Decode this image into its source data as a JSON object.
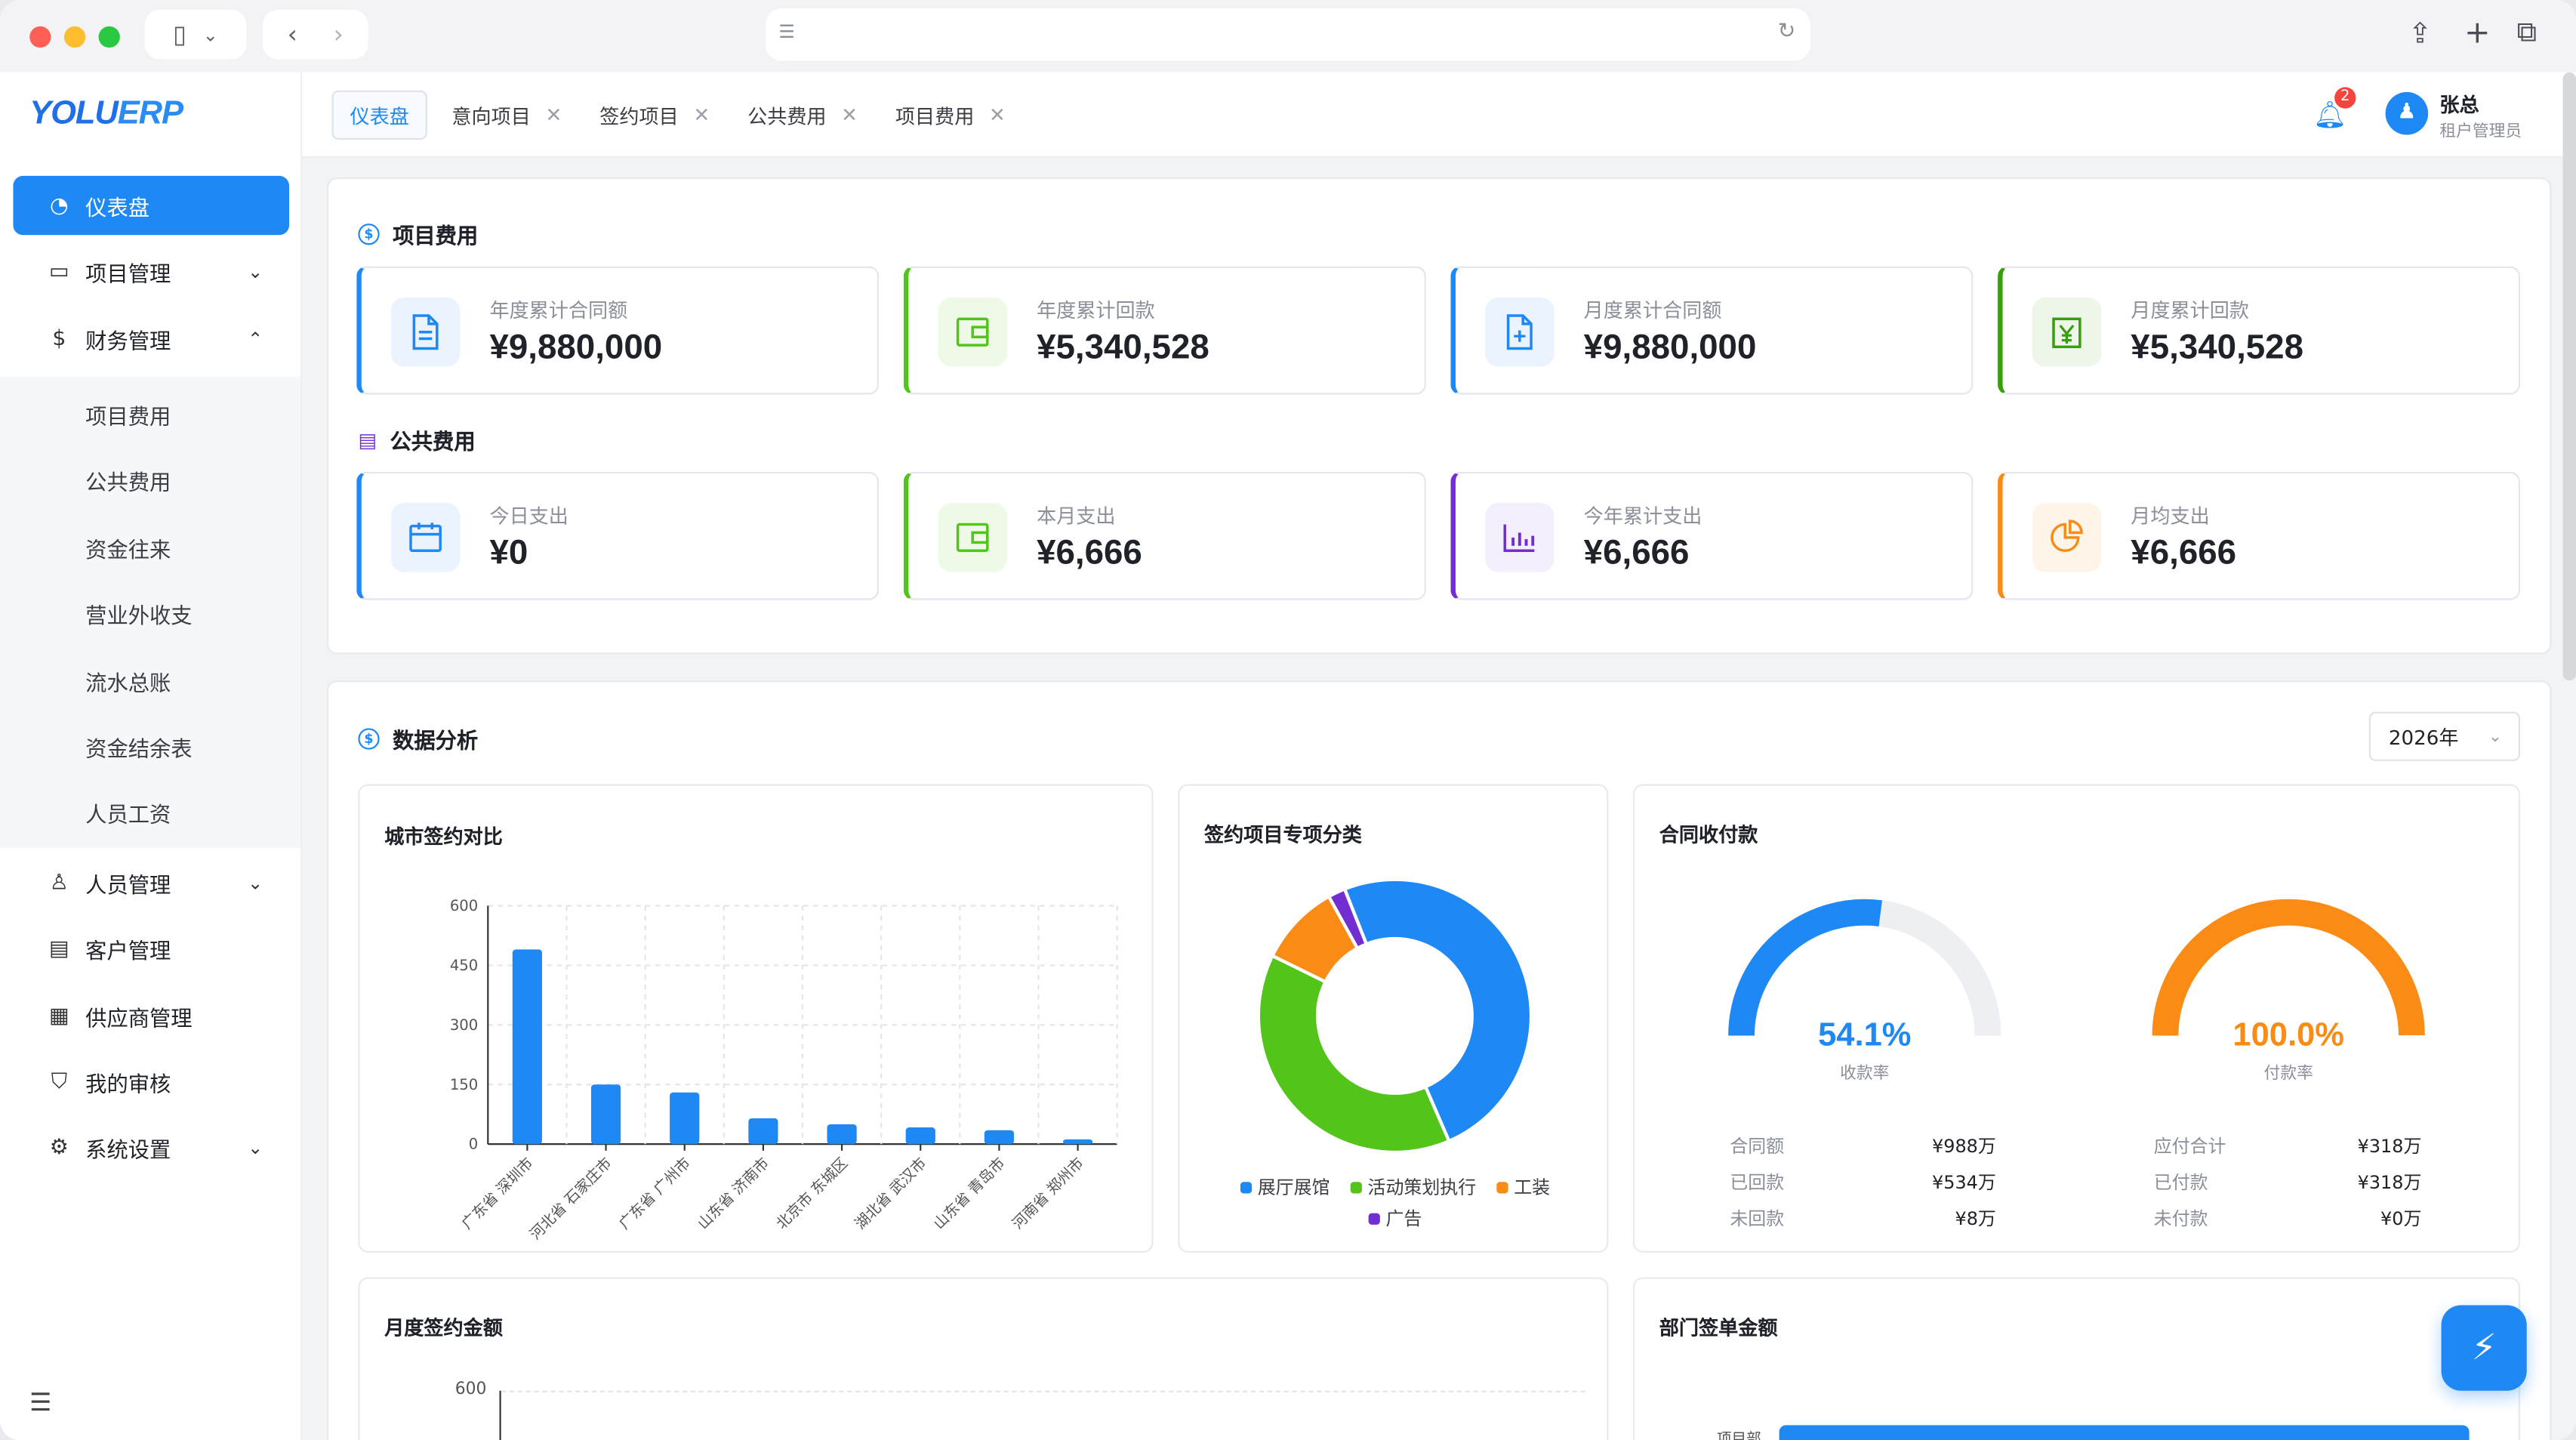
{
  "browser": {
    "url": ""
  },
  "sidebar": {
    "logo_main": "YOLU",
    "logo_accent": "ERP",
    "items": [
      {
        "label": "仪表盘",
        "icon": "dashboard-icon"
      },
      {
        "label": "项目管理",
        "icon": "folder-icon"
      },
      {
        "label": "财务管理",
        "icon": "finance-icon"
      },
      {
        "label": "人员管理",
        "icon": "people-icon"
      },
      {
        "label": "客户管理",
        "icon": "customer-icon"
      },
      {
        "label": "供应商管理",
        "icon": "supplier-icon"
      },
      {
        "label": "我的审核",
        "icon": "shield-icon"
      },
      {
        "label": "系统设置",
        "icon": "gear-icon"
      }
    ],
    "finance_sub": [
      "项目费用",
      "公共费用",
      "资金往来",
      "营业外收支",
      "流水总账",
      "资金结余表",
      "人员工资"
    ]
  },
  "tabs": [
    {
      "label": "仪表盘"
    },
    {
      "label": "意向项目"
    },
    {
      "label": "签约项目"
    },
    {
      "label": "公共费用"
    },
    {
      "label": "项目费用"
    }
  ],
  "header": {
    "notification_count": "2",
    "user_name": "张总",
    "user_role": "租户管理员"
  },
  "project_cost": {
    "title": "项目费用",
    "cards": [
      {
        "label": "年度累计合同额",
        "value": "¥9,880,000",
        "color": "#1e88f5"
      },
      {
        "label": "年度累计回款",
        "value": "¥5,340,528",
        "color": "#52c41a"
      },
      {
        "label": "月度累计合同额",
        "value": "¥9,880,000",
        "color": "#1e88f5"
      },
      {
        "label": "月度累计回款",
        "value": "¥5,340,528",
        "color": "#389e0d"
      }
    ]
  },
  "public_cost": {
    "title": "公共费用",
    "cards": [
      {
        "label": "今日支出",
        "value": "¥0",
        "color": "#1e88f5"
      },
      {
        "label": "本月支出",
        "value": "¥6,666",
        "color": "#52c41a"
      },
      {
        "label": "今年累计支出",
        "value": "¥6,666",
        "color": "#722ed1"
      },
      {
        "label": "月均支出",
        "value": "¥6,666",
        "color": "#fa8c16"
      }
    ]
  },
  "analysis": {
    "title": "数据分析",
    "year": "2026年",
    "city_title": "城市签约对比",
    "category_title": "签约项目专项分类",
    "payment_title": "合同收付款",
    "monthly_title": "月度签约金额",
    "dept_title": "部门签单金额",
    "monthly_ytick": "600",
    "dept_label": "项目部"
  },
  "payment": {
    "collect": {
      "pct": "54.1%",
      "sub": "收款率",
      "fraction": 0.541,
      "color": "#1e88f5",
      "rows": [
        {
          "k": "合同额",
          "v": "¥988万"
        },
        {
          "k": "已回款",
          "v": "¥534万"
        },
        {
          "k": "未回款",
          "v": "¥8万"
        }
      ]
    },
    "pay": {
      "pct": "100.0%",
      "sub": "付款率",
      "fraction": 1.0,
      "color": "#fa8c16",
      "rows": [
        {
          "k": "应付合计",
          "v": "¥318万"
        },
        {
          "k": "已付款",
          "v": "¥318万"
        },
        {
          "k": "未付款",
          "v": "¥0万"
        }
      ]
    }
  },
  "chart_data": [
    {
      "type": "bar",
      "title": "城市签约对比",
      "categories": [
        "广东省 深圳市",
        "河北省 石家庄市",
        "广东省 广州市",
        "山东省 济南市",
        "北京市 东城区",
        "湖北省 武汉市",
        "山东省 青岛市",
        "河南省 郑州市"
      ],
      "values": [
        490,
        150,
        130,
        65,
        50,
        42,
        35,
        12
      ],
      "ylim": [
        0,
        600
      ],
      "yticks": [
        0,
        150,
        300,
        450,
        600
      ],
      "color": "#1e88f5",
      "grid": true
    },
    {
      "type": "pie",
      "title": "签约项目专项分类",
      "labels": [
        "展厅展馆",
        "活动策划执行",
        "工装",
        "广告"
      ],
      "values": [
        48.5,
        38,
        9.5,
        2
      ],
      "colors": [
        "#1e88f5",
        "#52c41a",
        "#fa8c16",
        "#722ed1"
      ],
      "legend": "bottom"
    }
  ]
}
